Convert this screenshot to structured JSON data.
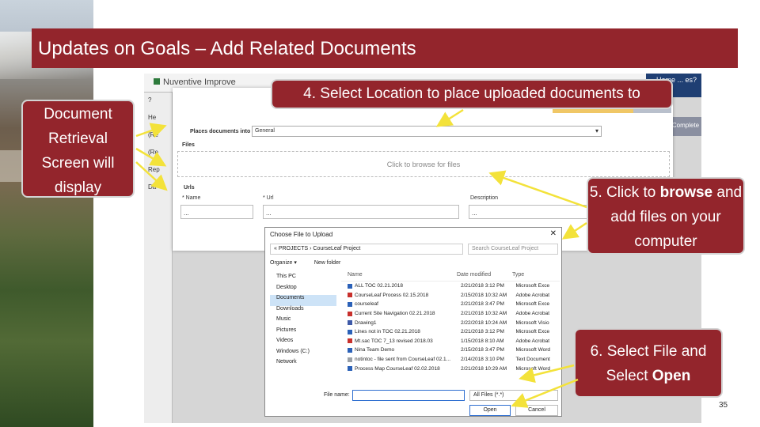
{
  "slide": {
    "title": "Updates on Goals – Add Related Documents",
    "number": "35"
  },
  "callouts": {
    "left": [
      "Document",
      "Retrieval",
      "Screen will",
      "display"
    ],
    "step4": "4. Select Location to place uploaded documents to",
    "step5": {
      "pre": "5. Click to ",
      "bold": "browse",
      "post": "and add files on your computer"
    },
    "step6": {
      "pre": "6. Select File and Select ",
      "bold": "Open"
    }
  },
  "app": {
    "brand": "Nuventive Improve",
    "user_badge": "Home ... es?",
    "side_items": [
      "?",
      "He",
      "(Re",
      "(Re",
      "Rep",
      "Da"
    ],
    "complete": "Complete"
  },
  "upload": {
    "place_label": "Places documents into",
    "place_value": "General",
    "files_label": "Files",
    "drop_text": "Click to browse for files",
    "urls_label": "Urls",
    "col_name": "* Name",
    "col_url": "* Url",
    "col_desc": "Description",
    "field_placeholder": "..."
  },
  "picker": {
    "title": "Choose File to Upload",
    "address": "«  PROJECTS  ›  CourseLeaf Project",
    "search": "Search CourseLeaf Project",
    "organize": "Organize ▾",
    "new_folder": "New folder",
    "nav": [
      "This PC",
      "Desktop",
      "Documents",
      "Downloads",
      "Music",
      "Pictures",
      "Videos",
      "Windows (C:)",
      "Network"
    ],
    "columns": {
      "name": "Name",
      "date": "Date modified",
      "type": "Type"
    },
    "files": [
      {
        "name": "ALL TOC 02.21.2018",
        "date": "2/21/2018 3:12 PM",
        "type": "Microsoft Exce",
        "kind": "xls"
      },
      {
        "name": "CourseLeaf Process 02.15.2018",
        "date": "2/15/2018 10:32 AM",
        "type": "Adobe Acrobat",
        "kind": "pdf"
      },
      {
        "name": "courseleaf",
        "date": "2/21/2018 3:47 PM",
        "type": "Microsoft Exce",
        "kind": "xls"
      },
      {
        "name": "Current Site Navigation 02.21.2018",
        "date": "2/21/2018 10:32 AM",
        "type": "Adobe Acrobat",
        "kind": "pdf"
      },
      {
        "name": "Drawing1",
        "date": "2/22/2018 10:24 AM",
        "type": "Microsoft Visio",
        "kind": "vsd"
      },
      {
        "name": "Lines not in TOC 02.21.2018",
        "date": "2/21/2018 3:12 PM",
        "type": "Microsoft Exce",
        "kind": "xls"
      },
      {
        "name": "Mt.sac TOC 7_13 revised 2018.03",
        "date": "1/15/2018 8:10 AM",
        "type": "Adobe Acrobat",
        "kind": "pdf"
      },
      {
        "name": "Nina Team Demo",
        "date": "2/15/2018 3:47 PM",
        "type": "Microsoft Word",
        "kind": "doc"
      },
      {
        "name": "notintoc - file sent from CourseLeaf 02.1...",
        "date": "2/14/2018 3:10 PM",
        "type": "Text Document",
        "kind": "txt"
      },
      {
        "name": "Process Map CourseLeaf 02.02.2018",
        "date": "2/21/2018 10:29 AM",
        "type": "Microsoft Word",
        "kind": "doc"
      }
    ],
    "filename_label": "File name:",
    "filter": "All Files (*.*)",
    "open": "Open",
    "cancel": "Cancel"
  },
  "colors": {
    "brand_red": "#93252c",
    "arrow": "#f3e23a"
  }
}
